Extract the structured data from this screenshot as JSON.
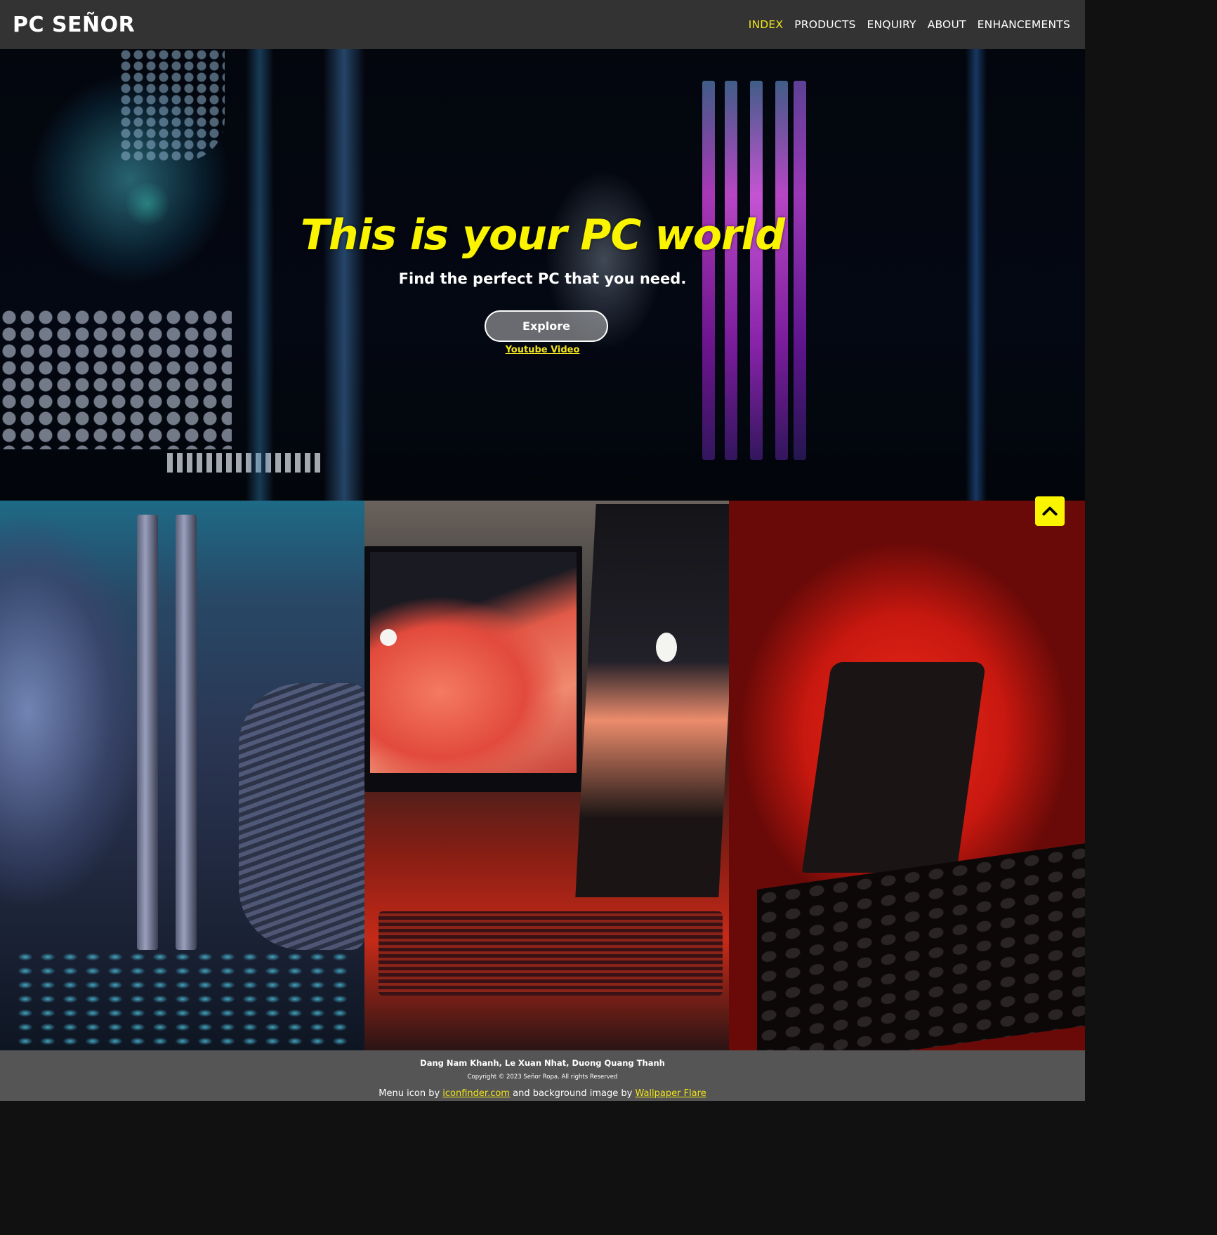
{
  "header": {
    "logo": "PC SEÑOR",
    "nav": [
      {
        "label": "INDEX",
        "active": true
      },
      {
        "label": "PRODUCTS",
        "active": false
      },
      {
        "label": "ENQUIRY",
        "active": false
      },
      {
        "label": "ABOUT",
        "active": false
      },
      {
        "label": "ENHANCEMENTS",
        "active": false
      }
    ]
  },
  "hero": {
    "title": "This is your PC world",
    "subtitle": "Find the perfect PC that you need.",
    "explore_label": "Explore",
    "video_link": "Youtube Video"
  },
  "back_to_top": {
    "icon": "chevron-up-icon"
  },
  "footer": {
    "authors": "Dang Nam Khanh, Le Xuan Nhat, Duong Quang Thanh",
    "copyright": "Copyright © 2023 Señor Ropa. All rights Reserved",
    "credits": {
      "prefix": "Menu icon by",
      "link1": "iconfinder.com",
      "middle": "and background image by",
      "link2": "Wallpaper Flare"
    }
  },
  "colors": {
    "accent": "#f2e51a",
    "header_bg": "#333333",
    "footer_bg": "#555555"
  }
}
